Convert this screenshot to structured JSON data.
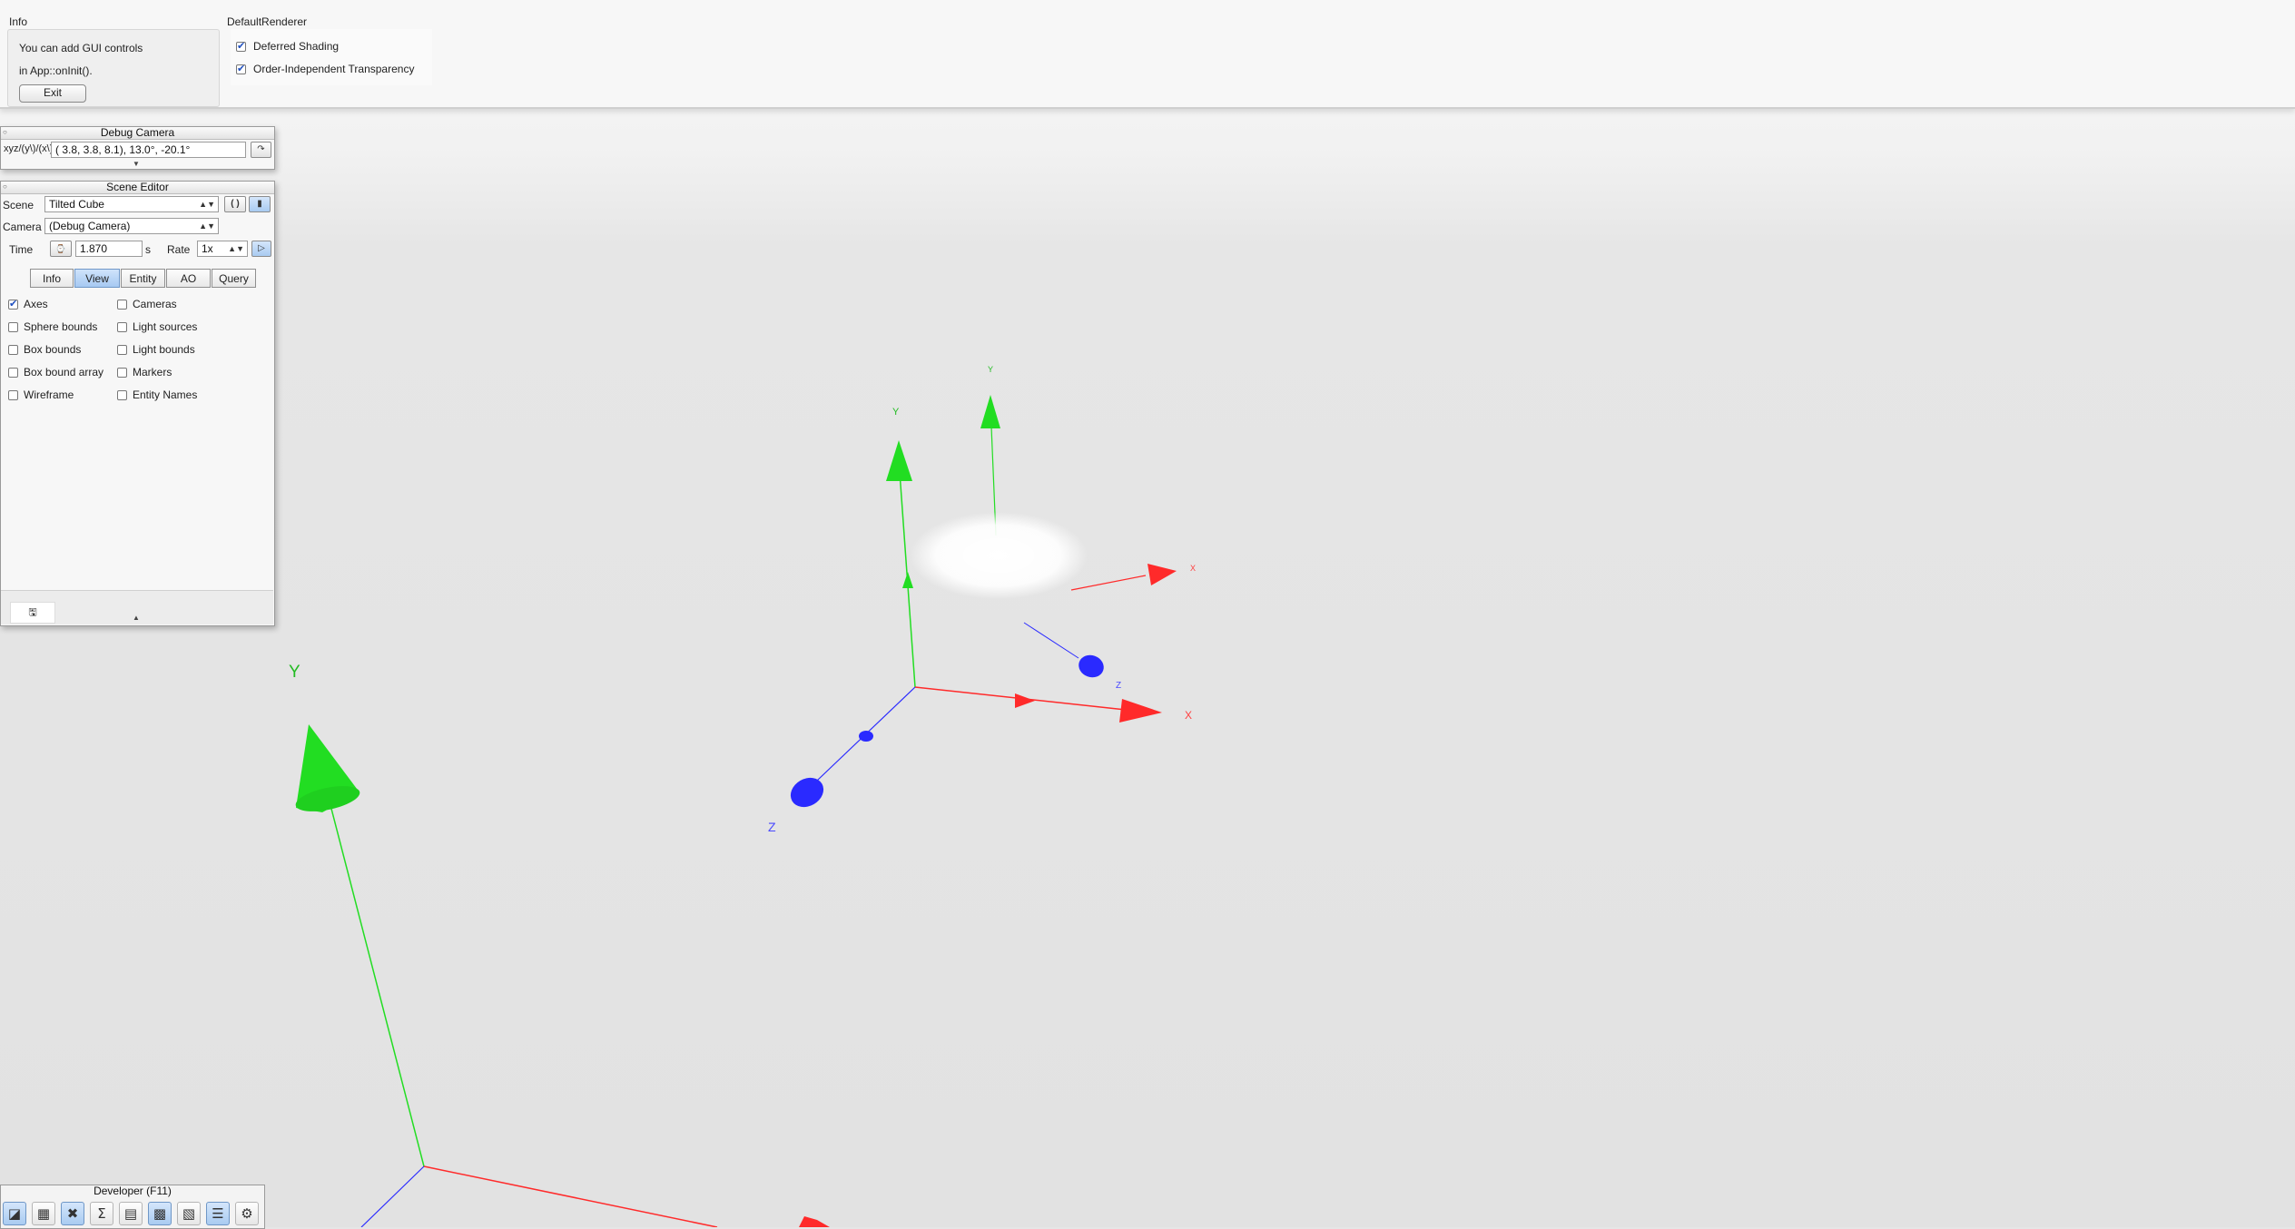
{
  "info_panel": {
    "title": "Info",
    "line1": "You can add GUI controls",
    "line2": "in App::onInit().",
    "exit_label": "Exit"
  },
  "renderer_panel": {
    "title": "DefaultRenderer",
    "deferred_shading": {
      "label": "Deferred Shading",
      "checked": true
    },
    "oit": {
      "label": "Order-Independent Transparency",
      "checked": true
    }
  },
  "debug_camera": {
    "title": "Debug Camera",
    "label": "xyzθφψ",
    "label_display": "xyz/(y\\)/(x\\)z",
    "value": "(  3.8,   3.8,   8.1),  13.0°, -20.1°",
    "bookmark_icon": "bookmark-icon"
  },
  "scene_editor": {
    "title": "Scene Editor",
    "scene_label": "Scene",
    "scene_value": "Tilted Cube",
    "camera_label": "Camera",
    "camera_value": "(Debug Camera)",
    "time_label": "Time",
    "time_value": "1.870",
    "time_unit": "s",
    "rate_label": "Rate",
    "rate_value": "1x",
    "tabs": [
      "Info",
      "View",
      "Entity",
      "AO",
      "Query"
    ],
    "active_tab": "View",
    "view_options_left": [
      {
        "label": "Axes",
        "checked": true
      },
      {
        "label": "Sphere bounds",
        "checked": false
      },
      {
        "label": "Box bounds",
        "checked": false
      },
      {
        "label": "Box bound array",
        "checked": false
      },
      {
        "label": "Wireframe",
        "checked": false
      }
    ],
    "view_options_right": [
      {
        "label": "Cameras",
        "checked": false
      },
      {
        "label": "Light sources",
        "checked": false
      },
      {
        "label": "Light bounds",
        "checked": false
      },
      {
        "label": "Markers",
        "checked": false
      },
      {
        "label": "Entity Names",
        "checked": false
      }
    ]
  },
  "developer_dock": {
    "title": "Developer (F11)",
    "icons": [
      "camera-icon",
      "film-clapper-icon",
      "tools-icon",
      "sigma-icon",
      "window-icon",
      "texture-browser-icon",
      "console-icon",
      "log-icon",
      "gear-icon"
    ]
  },
  "viewport_axes": {
    "labels": [
      "X",
      "Y",
      "Z"
    ],
    "colors": {
      "x": "#ff2a2a",
      "y": "#22dd22",
      "z": "#2a2aff"
    }
  }
}
